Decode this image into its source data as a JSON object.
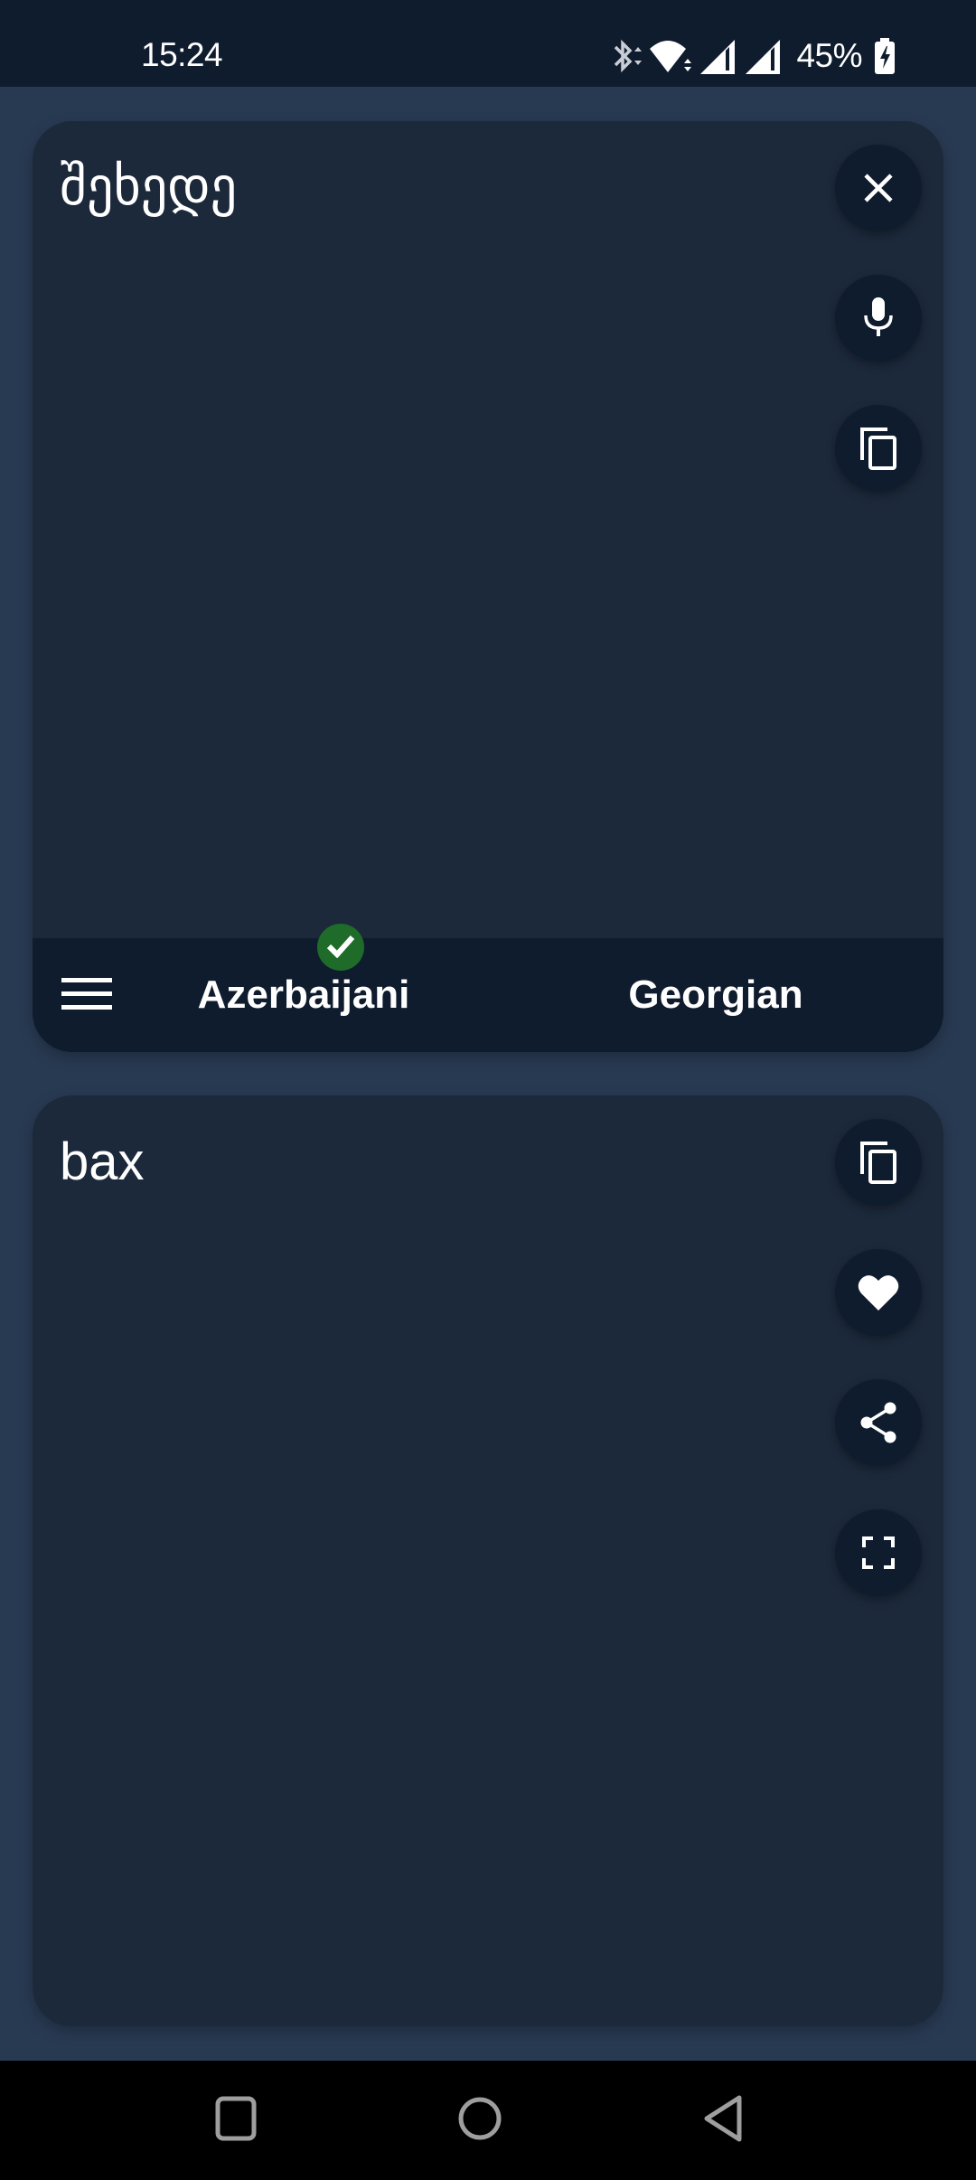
{
  "status_bar": {
    "time": "15:24",
    "battery_percent": "45%",
    "icons": [
      "bluetooth-icon",
      "wifi-icon",
      "signal-icon",
      "signal-icon",
      "battery-charging-icon"
    ]
  },
  "source_panel": {
    "text": "შეხედე",
    "actions": [
      {
        "name": "clear",
        "icon": "close-icon"
      },
      {
        "name": "voice-input",
        "icon": "microphone-icon"
      },
      {
        "name": "copy",
        "icon": "copy-icon"
      }
    ]
  },
  "language_bar": {
    "menu_icon": "hamburger-menu-icon",
    "source_language": "Azerbaijani",
    "target_language": "Georgian",
    "selected_indicator": "check-icon",
    "indicator_color": "#1e6b2a"
  },
  "result_panel": {
    "text": "bax",
    "actions": [
      {
        "name": "copy",
        "icon": "copy-icon"
      },
      {
        "name": "favorite",
        "icon": "heart-icon"
      },
      {
        "name": "share",
        "icon": "share-icon"
      },
      {
        "name": "fullscreen",
        "icon": "fullscreen-icon"
      }
    ]
  },
  "nav_bar": {
    "buttons": [
      "recents",
      "home",
      "back"
    ]
  },
  "colors": {
    "background": "#283a52",
    "card": "#1c293b",
    "bar": "#0f1c2e",
    "text": "#ffffff",
    "check": "#1e6b2a"
  }
}
